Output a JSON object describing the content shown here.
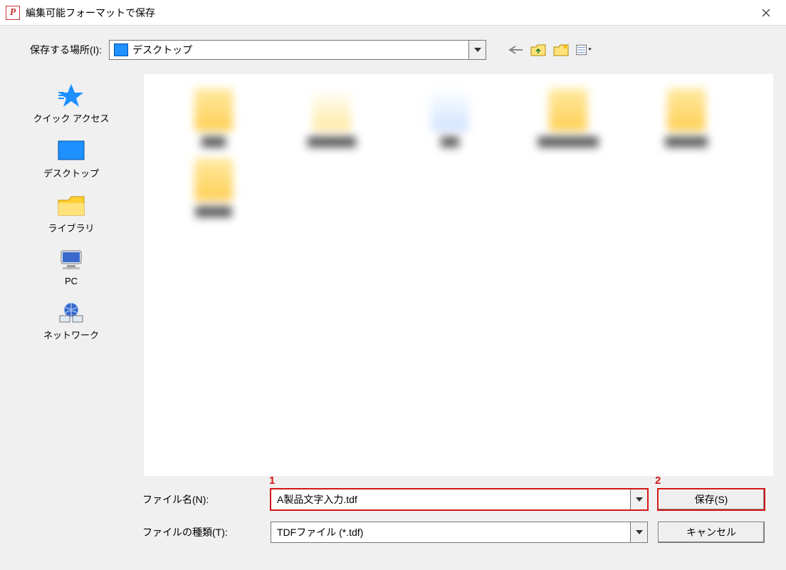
{
  "window": {
    "title": "編集可能フォーマットで保存",
    "app_icon_letter": "P"
  },
  "toolbar": {
    "location_label": "保存する場所(I):",
    "location_value": "デスクトップ",
    "icons": {
      "back": "back-icon",
      "up": "up-folder-icon",
      "new_folder": "new-folder-icon",
      "view": "view-menu-icon"
    }
  },
  "places": [
    {
      "id": "quick-access",
      "label": "クイック アクセス"
    },
    {
      "id": "desktop",
      "label": "デスクトップ"
    },
    {
      "id": "libraries",
      "label": "ライブラリ"
    },
    {
      "id": "pc",
      "label": "PC"
    },
    {
      "id": "network",
      "label": "ネットワーク"
    }
  ],
  "files_blurred_count": 6,
  "form": {
    "filename_label": "ファイル名(N):",
    "filename_value": "A製品文字入力.tdf",
    "filetype_label": "ファイルの種類(T):",
    "filetype_value": "TDFファイル (*.tdf)"
  },
  "buttons": {
    "save": "保存(S)",
    "cancel": "キャンセル"
  },
  "callouts": {
    "filename": "1",
    "save": "2"
  }
}
